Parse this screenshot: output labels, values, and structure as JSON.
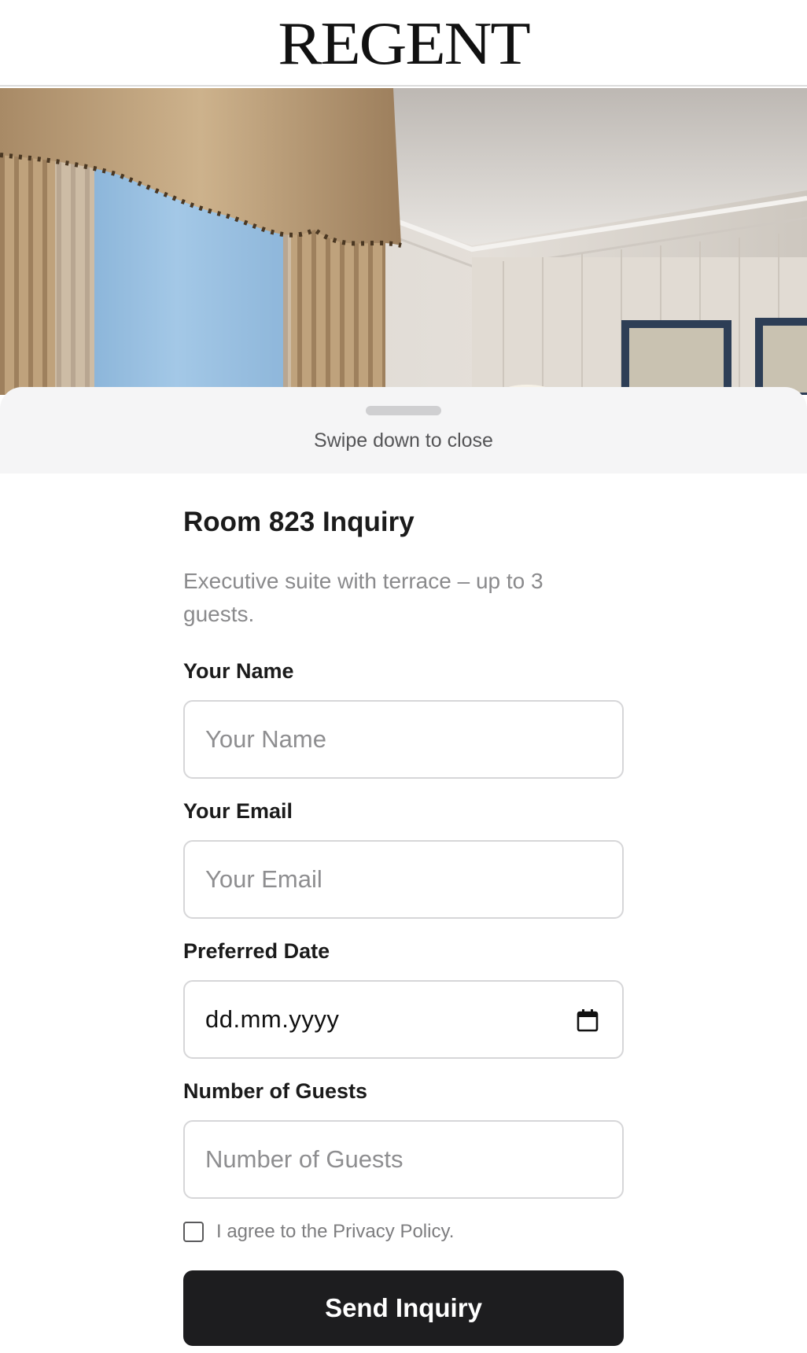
{
  "brand": {
    "logo_text": "REGENT"
  },
  "sheet": {
    "swipe_hint": "Swipe down to close"
  },
  "form": {
    "title": "Room 823 Inquiry",
    "subtitle": "Executive suite with terrace – up to 3 guests.",
    "fields": {
      "name": {
        "label": "Your Name",
        "placeholder": "Your Name"
      },
      "email": {
        "label": "Your Email",
        "placeholder": "Your Email"
      },
      "date": {
        "label": "Preferred Date",
        "value": "dd.mm.yyyy"
      },
      "guests": {
        "label": "Number of Guests",
        "placeholder": "Number of Guests"
      }
    },
    "privacy": {
      "label": "I agree to the Privacy Policy.",
      "checked": false
    },
    "submit_label": "Send Inquiry"
  },
  "icons": {
    "date_picker": "calendar-icon",
    "hero": "hotel-room-image"
  }
}
